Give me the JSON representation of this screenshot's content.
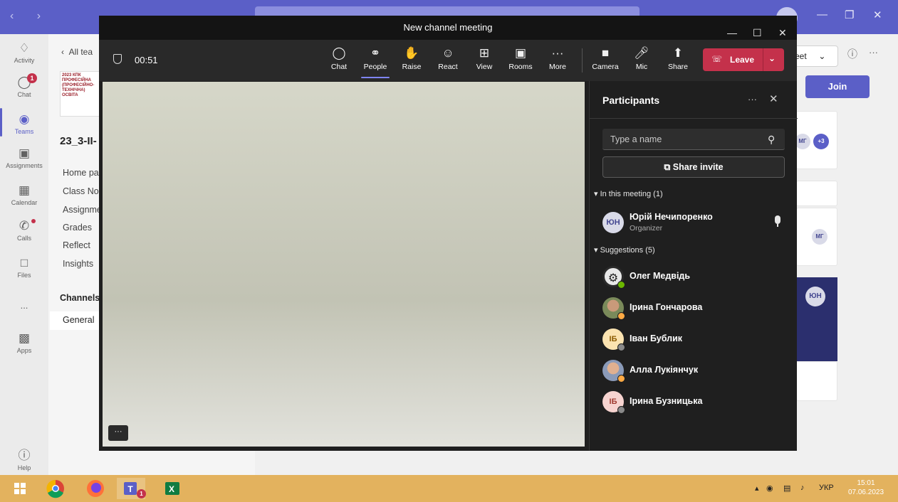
{
  "teams": {
    "rail": [
      {
        "label": "Activity",
        "icon": "bell-icon"
      },
      {
        "label": "Chat",
        "icon": "chat-icon",
        "badge": "1"
      },
      {
        "label": "Teams",
        "icon": "teams-icon"
      },
      {
        "label": "Assignments",
        "icon": "assignments-icon"
      },
      {
        "label": "Calendar",
        "icon": "calendar-icon"
      },
      {
        "label": "Calls",
        "icon": "phone-icon"
      },
      {
        "label": "Files",
        "icon": "file-icon"
      },
      {
        "label": "Apps",
        "icon": "apps-icon"
      },
      {
        "label": "Help",
        "icon": "help-icon"
      }
    ],
    "more_glyph": "...",
    "back_label": "All tea",
    "logo_text": "2023 КПК ПРОФЕСІЙНА (ПРОФЕСІЙНО-ТЕХНІЧНА) ОСВІТА",
    "team_name": "23_3-II-",
    "team_items": [
      "Home pa",
      "Class No",
      "Assignme",
      "Grades",
      "Reflect",
      "Insights"
    ],
    "channels_label": "Channels",
    "general_label": "General",
    "meet_label": "eet",
    "join_label": "Join",
    "avatars": {
      "mg": "МГ",
      "plus": "+3",
      "yun": "ЮН"
    }
  },
  "meeting": {
    "window_title": "New channel meeting",
    "timer": "00:51",
    "toolbar": [
      {
        "label": "Chat",
        "icon": "chat-icon"
      },
      {
        "label": "People",
        "icon": "people-icon",
        "selected": true
      },
      {
        "label": "Raise",
        "icon": "raise-hand-icon"
      },
      {
        "label": "React",
        "icon": "smile-icon"
      },
      {
        "label": "View",
        "icon": "grid-icon"
      },
      {
        "label": "Rooms",
        "icon": "rooms-icon"
      },
      {
        "label": "More",
        "icon": "more-icon"
      },
      {
        "label": "Camera",
        "icon": "camera-icon"
      },
      {
        "label": "Mic",
        "icon": "mic-icon"
      },
      {
        "label": "Share",
        "icon": "share-icon"
      }
    ],
    "leave_label": "Leave",
    "video_more": "···"
  },
  "participants": {
    "title": "Participants",
    "search_placeholder": "Type a name",
    "share_invite": "Share invite",
    "in_meeting_header": "In this meeting (1)",
    "in_meeting": [
      {
        "name": "Юрій Нечипоренко",
        "role": "Organizer",
        "initials": "ЮН"
      }
    ],
    "suggestions_header": "Suggestions (5)",
    "suggestions": [
      {
        "name": "Олег Медвідь",
        "initials": "",
        "status": "available",
        "avatar": "logo"
      },
      {
        "name": "Ірина Гончарова",
        "initials": "",
        "status": "away",
        "avatar": "photo"
      },
      {
        "name": "Іван Бублик",
        "initials": "ІБ",
        "status": "offline",
        "avatar": "initials"
      },
      {
        "name": "Алла Лукіянчук",
        "initials": "",
        "status": "away",
        "avatar": "photo"
      },
      {
        "name": "Ірина Бузницька",
        "initials": "ІБ",
        "status": "offline",
        "avatar": "initials"
      }
    ]
  },
  "taskbar": {
    "tray_lang": "УКР",
    "time": "15:01",
    "date": "07.06.2023",
    "teams_badge": "1"
  },
  "colors": {
    "teams_brand": "#5b5fc7",
    "leave_red": "#c4314b",
    "taskbar": "#e3b25e",
    "meeting_bg": "#1f1f1f"
  }
}
